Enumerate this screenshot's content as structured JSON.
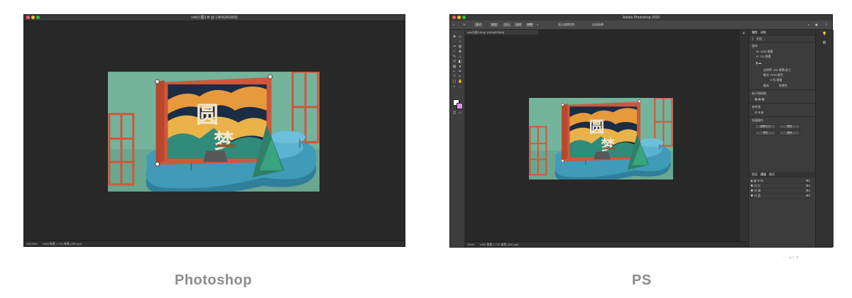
{
  "left_window": {
    "title": "c4d小图3.tif @ 145%(RGB/8)",
    "status_zoom": "145.49%",
    "status_info": "1080 像素 x 720 像素 (300 ppi)"
  },
  "right_window": {
    "title": "Adobe Photoshop 2020",
    "doc_tab": "c4d小图3.tif @ 100%(RGB/8)",
    "status_zoom": "100%",
    "status_info": "1080 像素 x 720 像素 (300 ppi)",
    "options_bar": [
      "模式",
      "缩放",
      "显示",
      "选择",
      "调整",
      "显示变换控件",
      "自动选择"
    ],
    "panel_tabs": [
      "属性",
      "调整"
    ],
    "properties_label": "文档",
    "canvas_section": "画布",
    "width_value": "W: 1080 像素",
    "height_value": "H: 720 像素",
    "resolution": "分辨率: 300 像素/英寸",
    "mode": "模式: RGB 颜色",
    "depth": "8 位/通道",
    "fill": "填充",
    "fill_value": "背景色",
    "rulers_section": "标尺和网格",
    "guides_section": "参考线",
    "quick_actions_section": "快速操作",
    "quick_actions": [
      "图像大小",
      "裁剪",
      "修剪",
      "旋转"
    ],
    "layers_tabs": [
      "图层",
      "通道",
      "路径"
    ],
    "layers": [
      "RGB",
      "红",
      "绿",
      "蓝"
    ],
    "layer_shortcuts": [
      "⌘2",
      "⌘3",
      "⌘4",
      "⌘5"
    ]
  },
  "captions": {
    "left": "Photoshop",
    "right": "PS"
  },
  "colors": {
    "scene_bg": "#74b39c",
    "frame": "#d0573a",
    "platform": "#3f9bb8",
    "close_dot": "#ff5f57",
    "min_dot": "#febc2e",
    "max_dot": "#28c840"
  }
}
